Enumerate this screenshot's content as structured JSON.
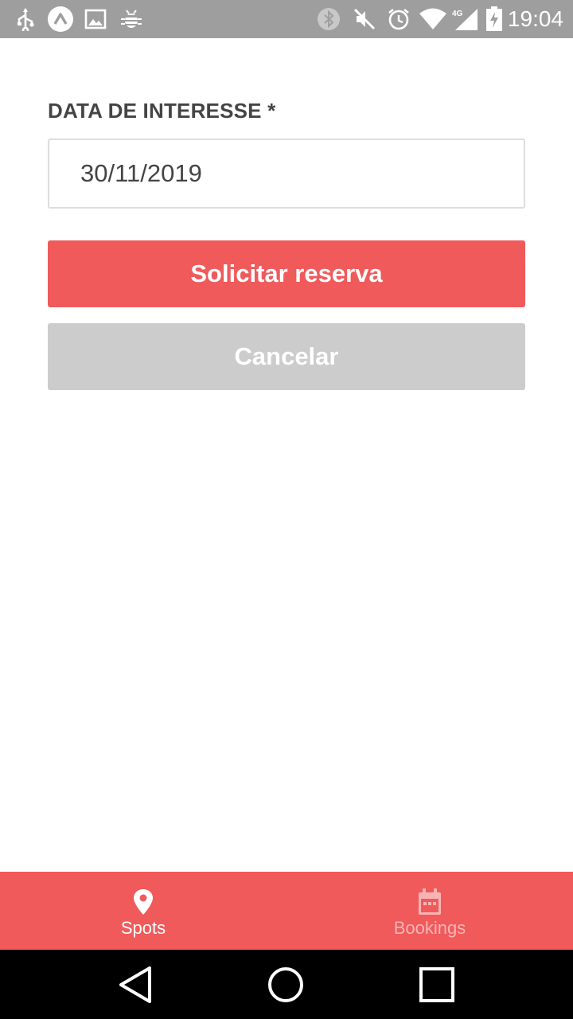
{
  "status_bar": {
    "time": "19:04",
    "network_label": "4G",
    "left_icons": [
      "usb-icon",
      "app-a-icon",
      "image-icon",
      "android-debug-icon"
    ],
    "right_icons": [
      "bluetooth-icon",
      "mute-icon",
      "alarm-icon",
      "wifi-icon",
      "signal-icon",
      "battery-charging-icon"
    ],
    "bg_color": "#9e9e9e"
  },
  "form": {
    "date_label": "DATA DE INTERESSE *",
    "date_value": "30/11/2019",
    "submit_label": "Solicitar reserva",
    "cancel_label": "Cancelar"
  },
  "tab_bar": {
    "tabs": [
      {
        "label": "Spots",
        "icon": "map-pin-icon",
        "active": true
      },
      {
        "label": "Bookings",
        "icon": "calendar-icon",
        "active": false
      }
    ],
    "bg_color": "#f05a5b"
  },
  "nav_bar": {
    "buttons": [
      "back-icon",
      "home-icon",
      "recents-icon"
    ]
  },
  "colors": {
    "accent": "#f05a5b",
    "disabled": "#cccccc",
    "label": "#444444"
  }
}
